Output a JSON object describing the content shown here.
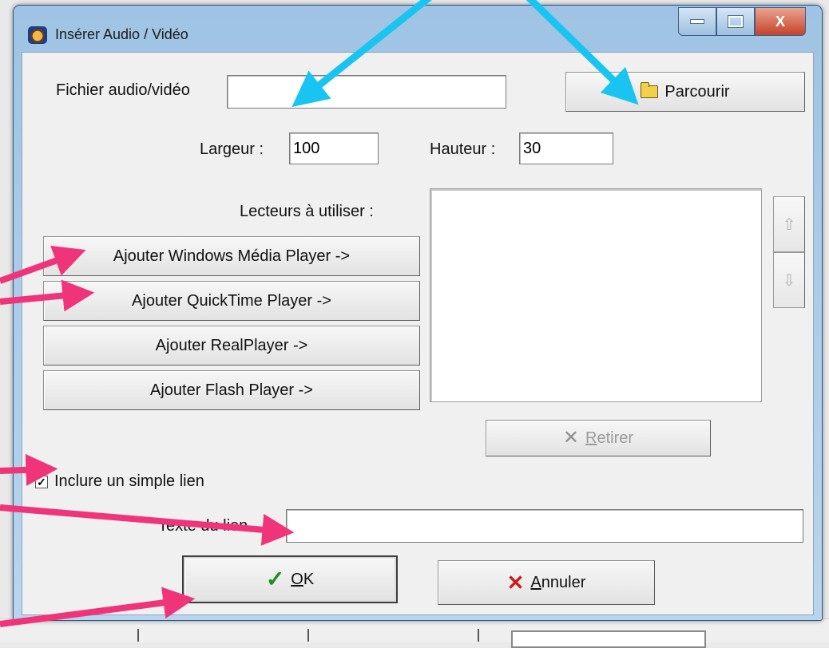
{
  "window": {
    "title": "Insérer Audio / Vidéo",
    "controls": {
      "minimize": "minimize",
      "maximize": "maximize",
      "close": "X"
    }
  },
  "file": {
    "label": "Fichier audio/vidéo",
    "value": "",
    "browse_button": "Parcourir"
  },
  "size": {
    "width_label": "Largeur :",
    "width_value": "100",
    "height_label": "Hauteur :",
    "height_value": "30"
  },
  "players": {
    "label": "Lecteurs à utiliser :",
    "buttons": [
      "Ajouter Windows Média Player ->",
      "Ajouter QuickTime Player ->",
      "Ajouter RealPlayer ->",
      "Ajouter Flash Player ->"
    ],
    "list_items": [],
    "remove_button_accel": "R",
    "remove_button_rest": "etirer"
  },
  "link": {
    "checkbox_label": "Inclure un simple lien",
    "checked": true,
    "text_label": "Texte du lien",
    "text_value": ""
  },
  "actions": {
    "ok_accel": "O",
    "ok_rest": "K",
    "cancel_accel": "A",
    "cancel_rest": "nnuler"
  },
  "colors": {
    "annotation_cyan": "#19c5f0",
    "annotation_pink": "#f0347a",
    "ok_check": "#1e8f1e",
    "cancel_x": "#cc1b1b"
  },
  "icons": [
    "app-icon",
    "folder-open-icon",
    "arrow-up-icon",
    "arrow-down-icon",
    "remove-x-icon",
    "checkmark-icon",
    "cancel-x-icon"
  ]
}
